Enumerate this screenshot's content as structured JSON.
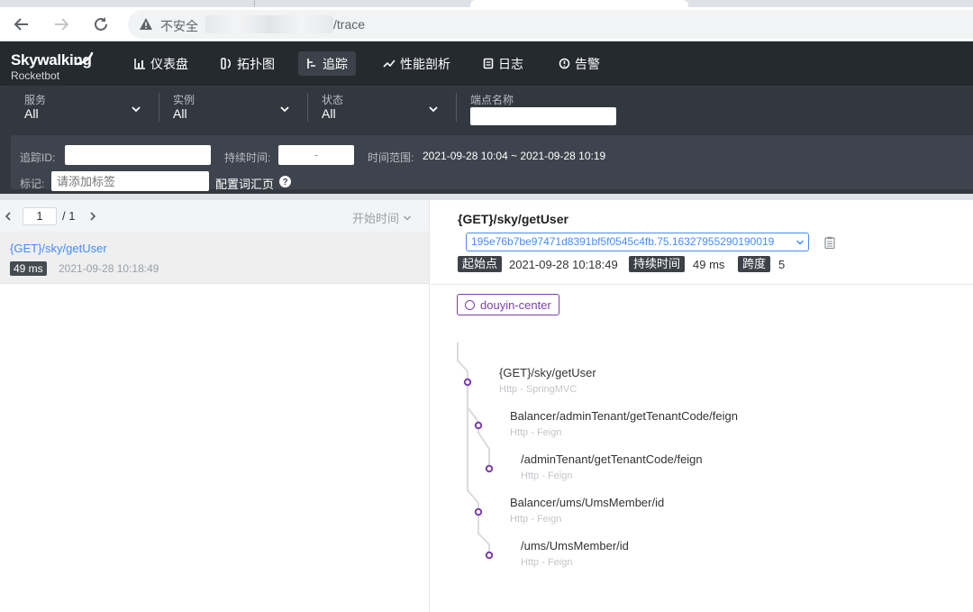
{
  "browser": {
    "security_label": "不安全",
    "url_path": "/trace"
  },
  "header": {
    "logo_main": "Skywalking",
    "logo_sub": "Rocketbot",
    "nav": [
      {
        "label": "仪表盘",
        "icon": "dashboard-icon"
      },
      {
        "label": "拓扑图",
        "icon": "topology-icon"
      },
      {
        "label": "追踪",
        "icon": "trace-icon",
        "active": true
      },
      {
        "label": "性能剖析",
        "icon": "profile-icon"
      },
      {
        "label": "日志",
        "icon": "log-icon"
      },
      {
        "label": "告警",
        "icon": "alarm-icon"
      }
    ]
  },
  "filters": {
    "service": {
      "label": "服务",
      "value": "All"
    },
    "instance": {
      "label": "实例",
      "value": "All"
    },
    "status": {
      "label": "状态",
      "value": "All"
    },
    "endpoint": {
      "label": "端点名称",
      "value": ""
    }
  },
  "query": {
    "trace_id_label": "追踪ID:",
    "duration_label": "持续时间:",
    "duration_sep": "-",
    "time_range_label": "时间范围:",
    "time_range_value": "2021-09-28 10:04 ~ 2021-09-28 10:19",
    "tag_label": "标记:",
    "tag_placeholder": "请添加标签",
    "glossary_link": "配置词汇页"
  },
  "list": {
    "page_current": "1",
    "page_total": "/ 1",
    "sort_label": "开始时间",
    "traces": [
      {
        "name": "{GET}/sky/getUser",
        "duration": "49 ms",
        "start": "2021-09-28 10:18:49"
      }
    ]
  },
  "detail": {
    "title": "{GET}/sky/getUser",
    "trace_id": "195e76b7be97471d8391bf5f0545c4fb.75.16327955290190019",
    "start_label": "起始点",
    "start_value": "2021-09-28 10:18:49",
    "duration_label": "持续时间",
    "duration_value": "49 ms",
    "span_count_label": "跨度",
    "span_count_value": "5",
    "service_tag": "douyin-center",
    "spans": [
      {
        "name": "{GET}/sky/getUser",
        "component": "Http - SpringMVC",
        "depth": 0
      },
      {
        "name": "Balancer/adminTenant/getTenantCode/feign",
        "component": "Http - Feign",
        "depth": 1
      },
      {
        "name": "/adminTenant/getTenantCode/feign",
        "component": "Http - Feign",
        "depth": 2
      },
      {
        "name": "Balancer/ums/UmsMember/id",
        "component": "Http - Feign",
        "depth": 1
      },
      {
        "name": "/ums/UmsMember/id",
        "component": "Http - Feign",
        "depth": 2
      }
    ]
  },
  "colors": {
    "header_bg": "#252a2f",
    "filter_bg": "#333840",
    "link_blue": "#448dfe",
    "span_purple": "#7b3fb0"
  }
}
